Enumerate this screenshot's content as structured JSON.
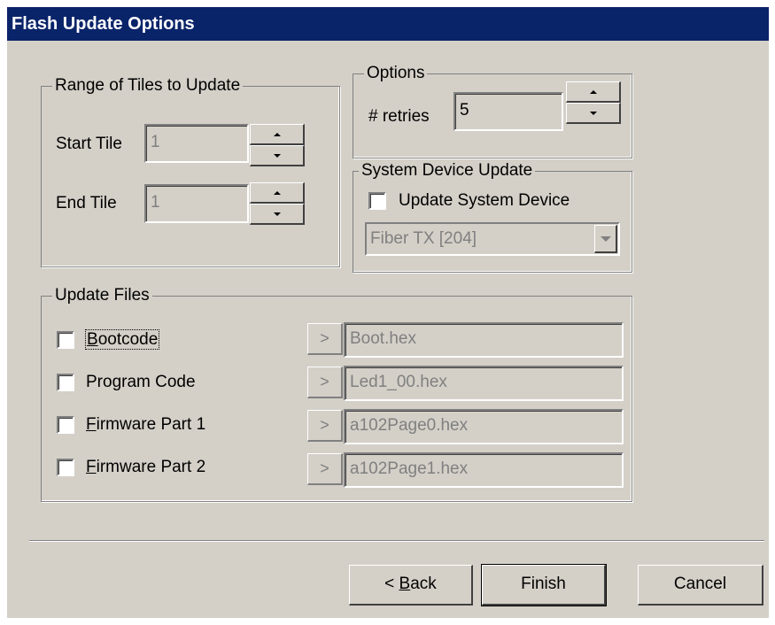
{
  "window": {
    "title": "Flash Update Options"
  },
  "range_group": {
    "legend": "Range of Tiles to Update",
    "start_label": "Start Tile",
    "start_value": "1",
    "end_label": "End Tile",
    "end_value": "1"
  },
  "options_group": {
    "legend": "Options",
    "retries_label": "# retries",
    "retries_value": "5"
  },
  "system_group": {
    "legend": "System Device Update",
    "checkbox_label": "Update System Device",
    "device_value": "Fiber TX [204]"
  },
  "files_group": {
    "legend": "Update Files",
    "browse_glyph": ">",
    "items": [
      {
        "label": "Bootcode",
        "mnemonic": "B",
        "rest": "ootcode",
        "file": "Boot.hex"
      },
      {
        "label": "Program Code",
        "file": "Led1_00.hex"
      },
      {
        "label": "Firmware Part 1",
        "mnemonic": "F",
        "rest": "irmware Part 1",
        "file": "a102Page0.hex"
      },
      {
        "label": "Firmware Part 2",
        "mnemonic": "F",
        "rest": "irmware Part 2",
        "file": "a102Page1.hex"
      }
    ]
  },
  "buttons": {
    "back_prefix": "< ",
    "back_mnemonic": "B",
    "back_rest": "ack",
    "finish": "Finish",
    "cancel": "Cancel"
  },
  "colors": {
    "titlebar": "#0a246a",
    "face": "#d4d0c8",
    "disabled_text": "#808080"
  }
}
